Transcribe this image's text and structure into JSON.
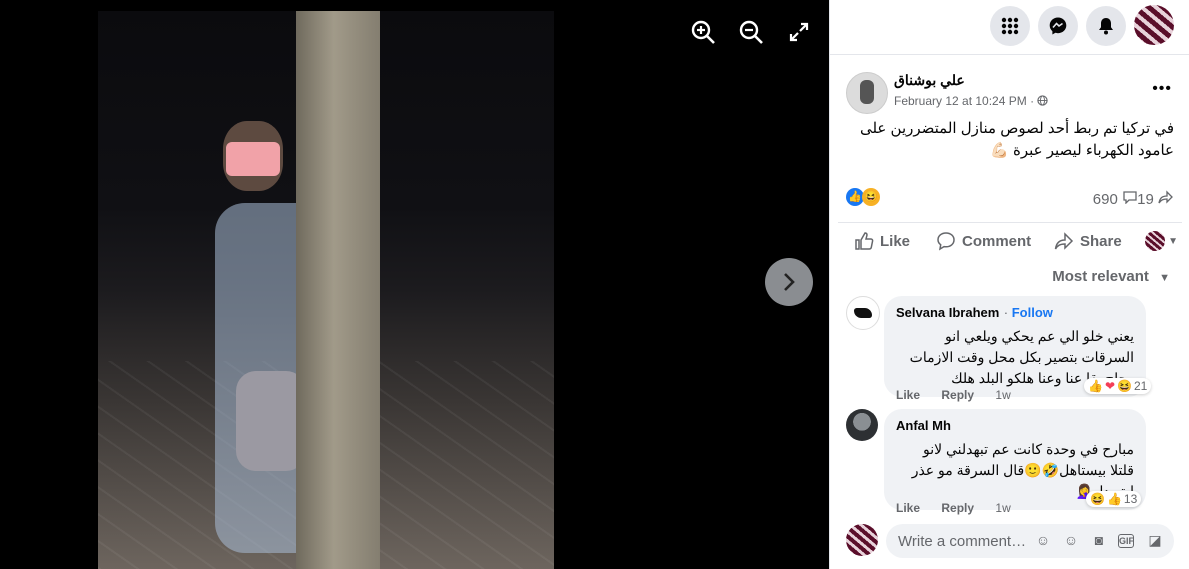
{
  "viewer": {
    "zoom_in": "zoom-in",
    "zoom_out": "zoom-out",
    "fullscreen": "fullscreen",
    "next": "next-photo"
  },
  "post": {
    "author": "علي بوشناق",
    "date": "February 12 at 10:24 PM",
    "privacy_icon": "globe-icon",
    "text": "في تركيا تم ربط أحد لصوص منازل المتضررين على عامود الكهرباء ليصير عبرة 💪🏻",
    "comment_count": "690",
    "share_count": "19"
  },
  "actions": {
    "like": "Like",
    "comment": "Comment",
    "share": "Share"
  },
  "sort_label": "Most relevant",
  "comments": [
    {
      "name": "Selvana Ibrahem",
      "follow": "Follow",
      "text": "يعني خلو الي عم يحكي ويلعي انو السرقات بتصير بكل محل وقت الازمات وحاج يقا عنا وعنا هلكو البلد هلك",
      "like": "Like",
      "reply": "Reply",
      "time": "1w",
      "reactions": "21"
    },
    {
      "name": "Anfal Mh",
      "text": "مبارح في وحدة كانت عم تبهدلني لانو قلتلا بيستاهل🤣🙂قال السرقة مو عذر ليتبهدل🤦‍♀️",
      "like": "Like",
      "reply": "Reply",
      "time": "1w",
      "reactions": "13"
    }
  ],
  "composer": {
    "placeholder": "Write a comment…"
  }
}
